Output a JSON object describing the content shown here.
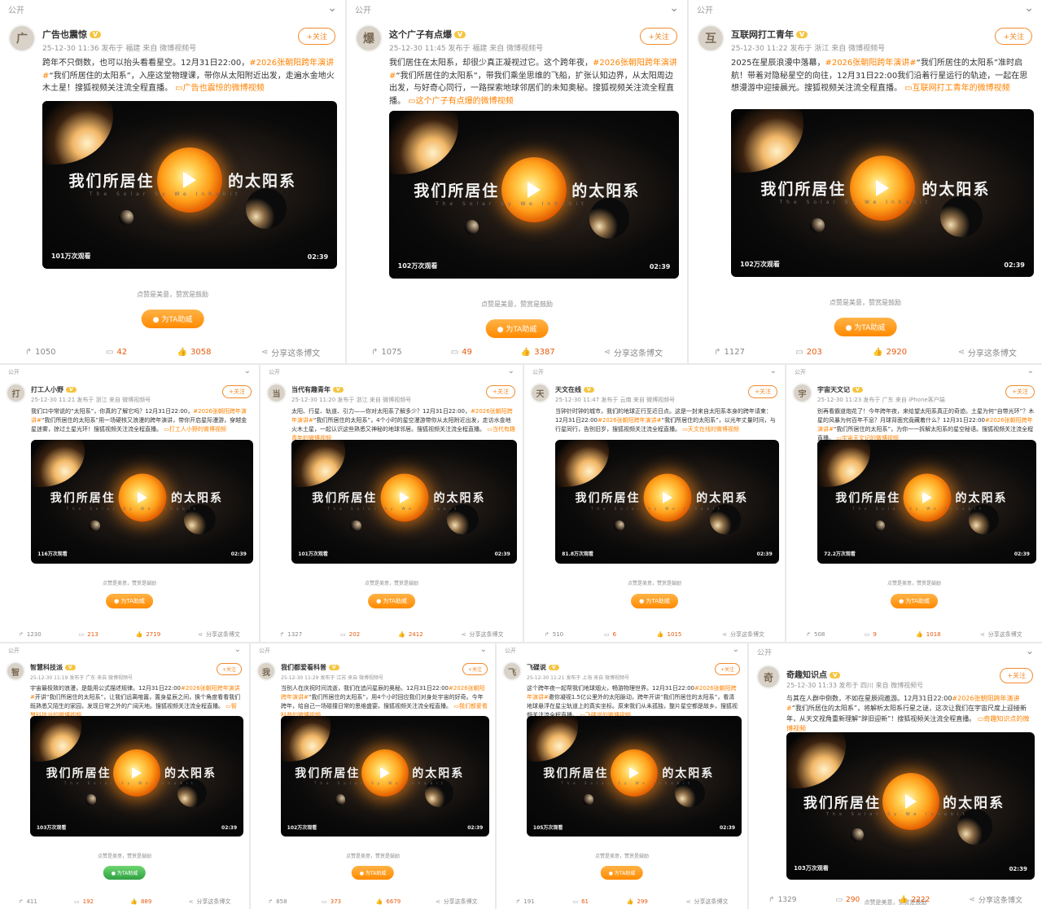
{
  "common": {
    "visibility": "公开",
    "follow": "+关注",
    "prompt": "点赞是美意，赞赏是鼓励",
    "boost": "为TA助威",
    "share": "分享这条博文",
    "video": {
      "title_left": "我们所居住",
      "title_right": "的太阳系",
      "subtitle": "The Solar Sy          We Inhabit",
      "duration": "02:39"
    }
  },
  "icons": {
    "repost": "repost-icon",
    "comment": "comment-icon",
    "like": "like-icon",
    "share": "share-icon",
    "play": "play-icon",
    "chevron": "chevron-down-icon"
  },
  "colors": {
    "accent": "#ff8200",
    "follow_border": "#f08a2b",
    "boost": "#ff8a00",
    "boost_green": "#2ea043",
    "like_count": "#e8590c"
  },
  "posts": [
    {
      "username": "广告也震惊",
      "avatar": "广",
      "meta": "25-12-30 11:36 发布于 福建 来自 微博视频号",
      "text": "跨年不只倒数，也可以抬头看看星空。12月31日22:00，",
      "hashtag": "#2026张朝阳跨年演讲#",
      "text2": "“我们所居住的太阳系”，入座这堂物理课，带你从太阳附近出发，走遍水金地火木土星！搜狐视频关注流全程直播。",
      "link": "广告也震惊的微博视频",
      "views": "101万次观看",
      "repost": "1050",
      "comment": "42",
      "like": "3058"
    },
    {
      "username": "这个广子有点爆",
      "avatar": "爆",
      "meta": "25-12-30 11:45 发布于 福建 来自 微博视频号",
      "text": "我们居住在太阳系，却很少真正凝视过它。这个跨年夜，",
      "hashtag": "#2026张朝阳跨年演讲#",
      "text2": "“我们所居住的太阳系”，带我们乘坐思维的飞船，扩张认知边界，从太阳周边出发，与好奇心同行，一路探索地球邻居们的未知奥秘。搜狐视频关注流全程直播。",
      "link": "这个广子有点爆的微博视频",
      "views": "102万次观看",
      "repost": "1075",
      "comment": "49",
      "like": "3387"
    },
    {
      "username": "互联网打工青年",
      "avatar": "互",
      "meta": "25-12-30 11:22 发布于 浙江 来自 微博视频号",
      "text": "2025在星辰浪漫中落幕，",
      "hashtag": "#2026张朝阳跨年演讲#",
      "text2": "“我们所居住的太阳系”准时启航！带着对隐秘星空的向往，12月31日22:00我们沿着行星运行的轨迹，一起在思想漫游中迎接晨光。搜狐视频关注流全程直播。",
      "link": "互联网打工青年的微博视频",
      "views": "102万次观看",
      "repost": "1127",
      "comment": "203",
      "like": "2920"
    },
    {
      "username": "打工人小野",
      "avatar": "打",
      "meta": "25-12-30 11:21 发布于 浙江 来自 微博视频号",
      "text": "我们口中常说的“太阳系”，你真的了解它吗？12月31日22:00，",
      "hashtag": "#2026张朝阳跨年演讲#",
      "text2": "“我们所居住的太阳系”用一场硬核又浪漫的跨年演讲，带你开启星际漫游，穿越金星迷雾，掠过土星光环！搜狐视频关注流全程直播。",
      "link": "打工人小野的微博视频",
      "views": "116万次观看",
      "repost": "1230",
      "comment": "213",
      "like": "2719"
    },
    {
      "username": "当代有趣青年",
      "avatar": "当",
      "meta": "25-12-30 11:20 发布于 浙江 来自 微博视频号",
      "text": "太阳、行星、轨道、引力——你对太阳系了解多少？12月31日22:00，",
      "hashtag": "#2026张朝阳跨年演讲#",
      "text2": "“我们所居住的太阳系”，4个小时的星空漫游带你从太阳附近出发，走访水金地火木土星，一起认识这些熟悉又神秘的地球邻居。搜狐视频关注流全程直播。",
      "link": "当代有趣青年的微博视频",
      "views": "101万次观看",
      "repost": "1327",
      "comment": "202",
      "like": "2412"
    },
    {
      "username": "天文在线",
      "avatar": "天",
      "meta": "25-12-30 11:47 发布于 云南 来自 微博视频号",
      "text": "当钟针时钟的城市，我们的地球正行至近日点。这是一封来自太阳系本身的跨年请柬：12月31日22:00",
      "hashtag": "#2026张朝阳跨年演讲#",
      "text2": "“我们所居住的太阳系”，以光年丈量时间，与行星同行，告别旧岁，搜狐视频关注流全程直播。",
      "link": "天文在线的微博视频",
      "views": "81.8万次观看",
      "repost": "510",
      "comment": "6",
      "like": "1015"
    },
    {
      "username": "宇宙天文记",
      "avatar": "宇",
      "meta": "25-12-30 11:23 发布于 广东 来自 iPhone客户端",
      "text": "别再看霸道炮花了！今年跨年夜，来给望太阳系真正的奇迹。土星为何“自带光环”？木星的风暴为何百年不息？月球背面究竟藏着什么？12月31日22:00",
      "hashtag": "#2026张朝阳跨年演讲#",
      "text2": "“我们所居住的太阳系”，为你一一拆解太阳系的星空秘语。搜狐视频关注流全程直播。",
      "link": "宇宙天文记的微博视频",
      "views": "72.2万次观看",
      "repost": "508",
      "comment": "9",
      "like": "1018"
    },
    {
      "username": "智慧科技派",
      "avatar": "智",
      "meta": "25-12-30 11:19 发布于 广东 来自 微博视频号",
      "text": "宇宙最极致的浪漫，是能用公式描述规律。12月31日22:00",
      "hashtag": "#2026张朝阳跨年演讲#",
      "text2": "开讲“我们所居住的太阳系”，让我们远离喧嚣，置身星辰之间，换个角度看看我们既熟悉又陌生的家园，发现日常之外的广阔天地。搜狐视频关注流全程直播。",
      "link": "智慧科技派的微博视频",
      "views": "103万次观看",
      "repost": "411",
      "comment": "192",
      "like": "889"
    },
    {
      "username": "我们都爱看科普",
      "avatar": "我",
      "meta": "25-12-30 11:29 发布于 江苏 来自 微博视频号",
      "text": "当别人在庆祝时间流逝，我们在追问星辰的奥秘。12月31日22:00",
      "hashtag": "#2026张朝阳跨年演讲#",
      "text2": "“我们所居住的太阳系”，用4个小时回应我们对身处宇宙的好奇。今年跨年，给自己一场碰撞日常的思维盛宴。搜狐视频关注流全程直播。",
      "link": "我们都爱看科普的微博视频",
      "views": "102万次观看",
      "repost": "858",
      "comment": "373",
      "like": "6679"
    },
    {
      "username": "飞碟说",
      "avatar": "飞",
      "meta": "25-12-30 11:21 发布于 上海 来自 微博视频号",
      "text": "这个跨年夜一起帮我们地球烟火，畅游物理世界。12月31日22:00",
      "hashtag": "#2026张朝阳跨年演讲#",
      "text2": "邀你凝视1.5亿公里外的太阳脉动，跨年开讲“我们所居住的太阳系”，看清地球悬浮在星尘轨道上的真实坐标。原来我们从未孤独，整片星空都是故乡。搜狐视频关注流全程直播。",
      "link": "飞碟说的微博视频",
      "views": "105万次观看",
      "repost": "191",
      "comment": "61",
      "like": "299"
    },
    {
      "username": "奇趣知识点",
      "avatar": "奇",
      "meta": "25-12-30 11:33 发布于 四川 来自 微博视频号",
      "text": "与其在人群中倒数，不如在星辰间遨游。12月31日22:00",
      "hashtag": "#2026张朝阳跨年演讲#",
      "text2": "“我们所居住的太阳系”，将解析太阳系行星之谜，这次让我们在宇宙尺度上迎接新年，从天文视角重新理解“辞旧迎新”！搜狐视频关注流全程直播。",
      "link": "奇趣知识点的微博视频",
      "views": "103万次观看",
      "repost": "1329",
      "comment": "290",
      "like": "2222"
    }
  ]
}
